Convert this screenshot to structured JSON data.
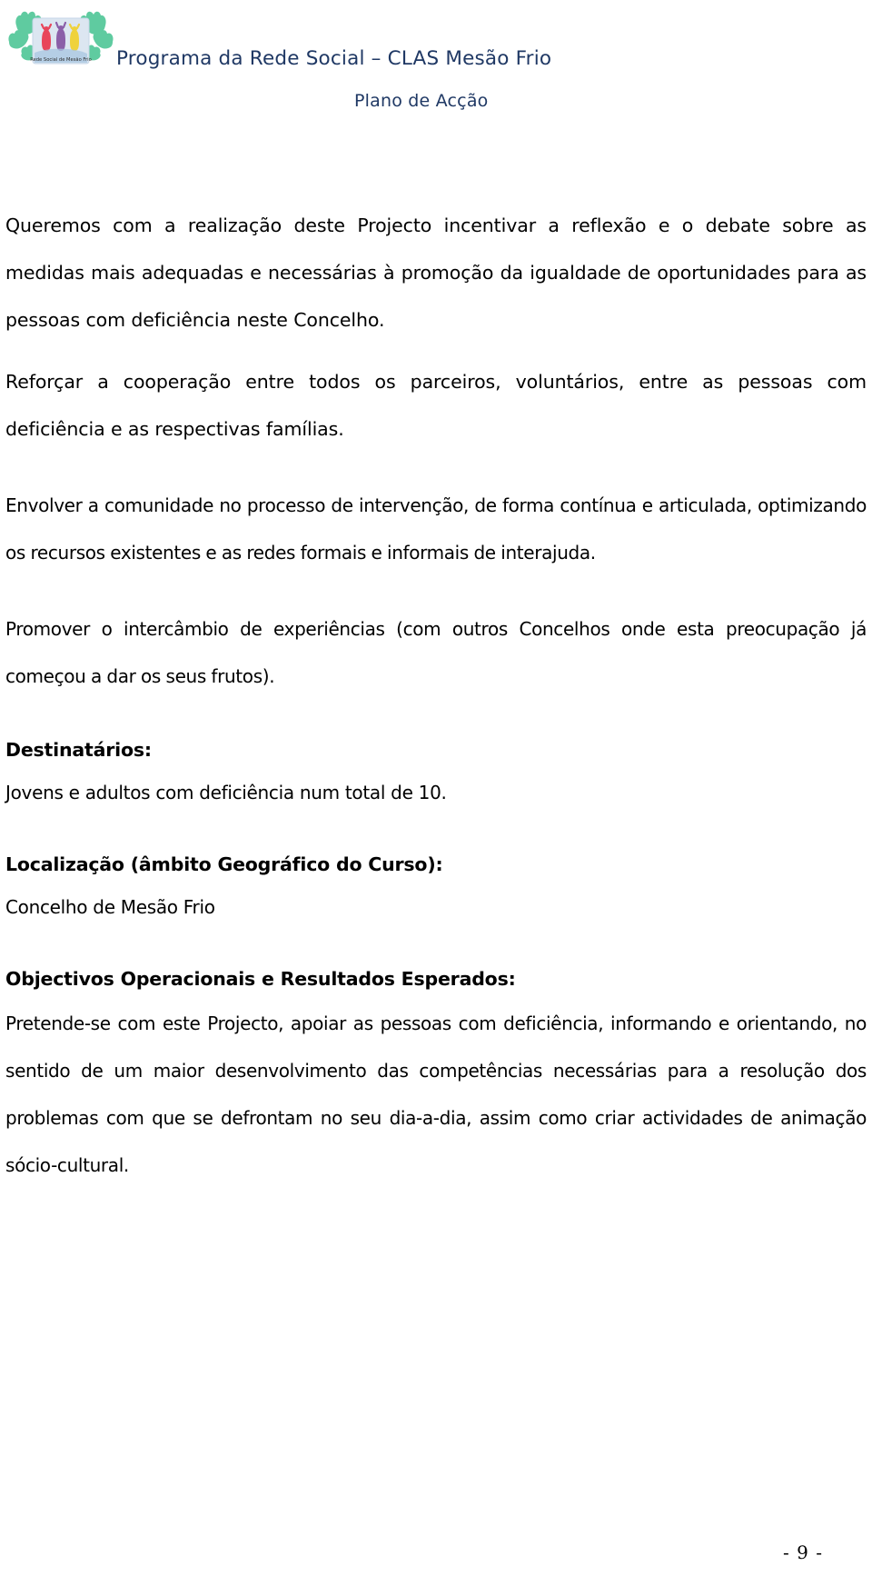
{
  "header": {
    "logo_alt": "Rede Social de Mesão Frio logo",
    "logo_caption": "Rede Social de Mesão Frio",
    "title": "Programa da Rede Social – CLAS Mesão Frio",
    "subtitle": "Plano de Acção",
    "title_color": "#1F3864",
    "logo_colors": {
      "hands": "#5FCBA0",
      "panel": "#DCE6F1",
      "figure_red": "#E8455A",
      "figure_purple": "#8B5FA8",
      "figure_yellow": "#EFD23C",
      "ground": "#A8C6E0"
    }
  },
  "body": {
    "paragraphs": [
      "Queremos com a realização deste Projecto incentivar a reflexão e o debate sobre as medidas mais adequadas e necessárias à promoção da igualdade de oportunidades para as pessoas com deficiência neste Concelho.",
      "Reforçar a cooperação entre todos os parceiros, voluntários, entre as pessoas com deficiência e as respectivas famílias.",
      "Envolver a comunidade no processo de intervenção, de forma contínua e articulada, optimizando os recursos existentes e as redes formais e informais de interajuda.",
      "Promover o intercâmbio de experiências (com outros Concelhos onde esta preocupação já começou a dar os seus frutos)."
    ],
    "sections": [
      {
        "heading": "Destinatários:",
        "text": "Jovens e adultos com deficiência num total de 10."
      },
      {
        "heading": "Localização (âmbito Geográfico do Curso):",
        "text": "Concelho de Mesão Frio"
      },
      {
        "heading": "Objectivos Operacionais e Resultados Esperados:",
        "text": "Pretende-se com este Projecto, apoiar as pessoas com deficiência, informando e orientando, no sentido de um maior desenvolvimento das competências necessárias para a resolução dos problemas com que se defrontam no seu dia-a-dia, assim como criar actividades de animação sócio-cultural."
      }
    ]
  },
  "footer": {
    "page_number": "- 9 -"
  }
}
